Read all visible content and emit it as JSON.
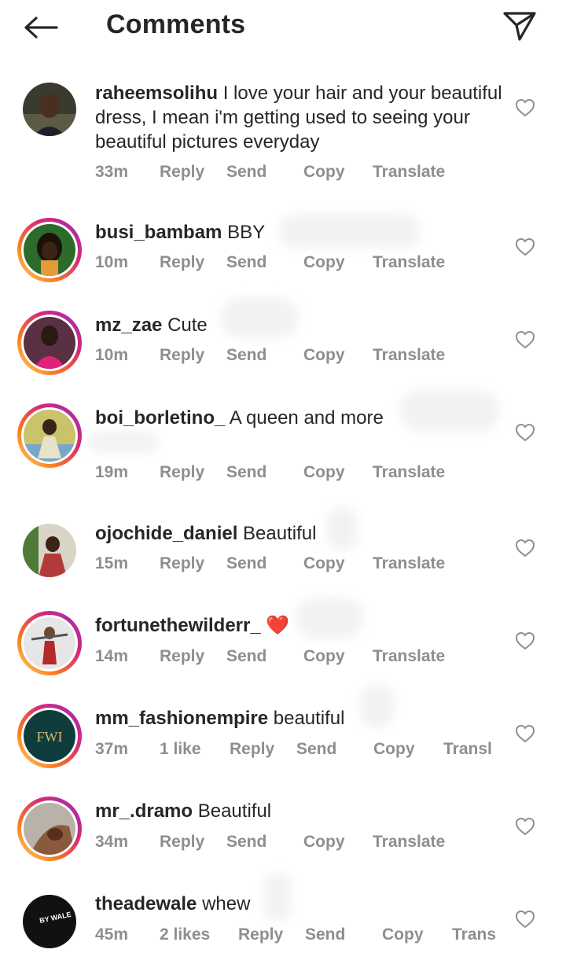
{
  "header": {
    "title": "Comments",
    "back_icon": "arrow-left-icon",
    "share_icon": "paper-plane-icon"
  },
  "colors": {
    "text": "#262626",
    "secondary": "#8e8e8e",
    "story_ring": [
      "#feda75",
      "#fa7e1e",
      "#d62976",
      "#962fbf"
    ],
    "heart_emoji": "#e0245e"
  },
  "comments": [
    {
      "username": "raheemsolihu",
      "text": "I love your hair and your beautiful dress, I mean i'm getting used to seeing your beautiful pictures everyday",
      "time": "33m",
      "reply": "Reply",
      "send": "Send",
      "copy": "Copy",
      "translate": "Translate"
    },
    {
      "username": "busi_bambam",
      "text": "BBY",
      "time": "10m",
      "reply": "Reply",
      "send": "Send",
      "copy": "Copy",
      "translate": "Translate"
    },
    {
      "username": "mz_zae",
      "text": "Cute",
      "time": "10m",
      "reply": "Reply",
      "send": "Send",
      "copy": "Copy",
      "translate": "Translate"
    },
    {
      "username": "boi_borletino_",
      "text": "A queen and more",
      "time": "19m",
      "reply": "Reply",
      "send": "Send",
      "copy": "Copy",
      "translate": "Translate"
    },
    {
      "username": "ojochide_daniel",
      "text": "Beautiful",
      "time": "15m",
      "reply": "Reply",
      "send": "Send",
      "copy": "Copy",
      "translate": "Translate"
    },
    {
      "username": "fortunethewilderr_",
      "text": "❤️",
      "time": "14m",
      "reply": "Reply",
      "send": "Send",
      "copy": "Copy",
      "translate": "Translate"
    },
    {
      "username": "mm_fashionempire",
      "text": "beautiful",
      "time": "37m",
      "likes": "1 like",
      "reply": "Reply",
      "send": "Send",
      "copy": "Copy",
      "translate": "Transl"
    },
    {
      "username": "mr_.dramo",
      "text": "Beautiful",
      "time": "34m",
      "reply": "Reply",
      "send": "Send",
      "copy": "Copy",
      "translate": "Translate"
    },
    {
      "username": "theadewale",
      "text": "whew",
      "time": "45m",
      "likes": "2 likes",
      "reply": "Reply",
      "send": "Send",
      "copy": "Copy",
      "translate": "Trans"
    }
  ]
}
